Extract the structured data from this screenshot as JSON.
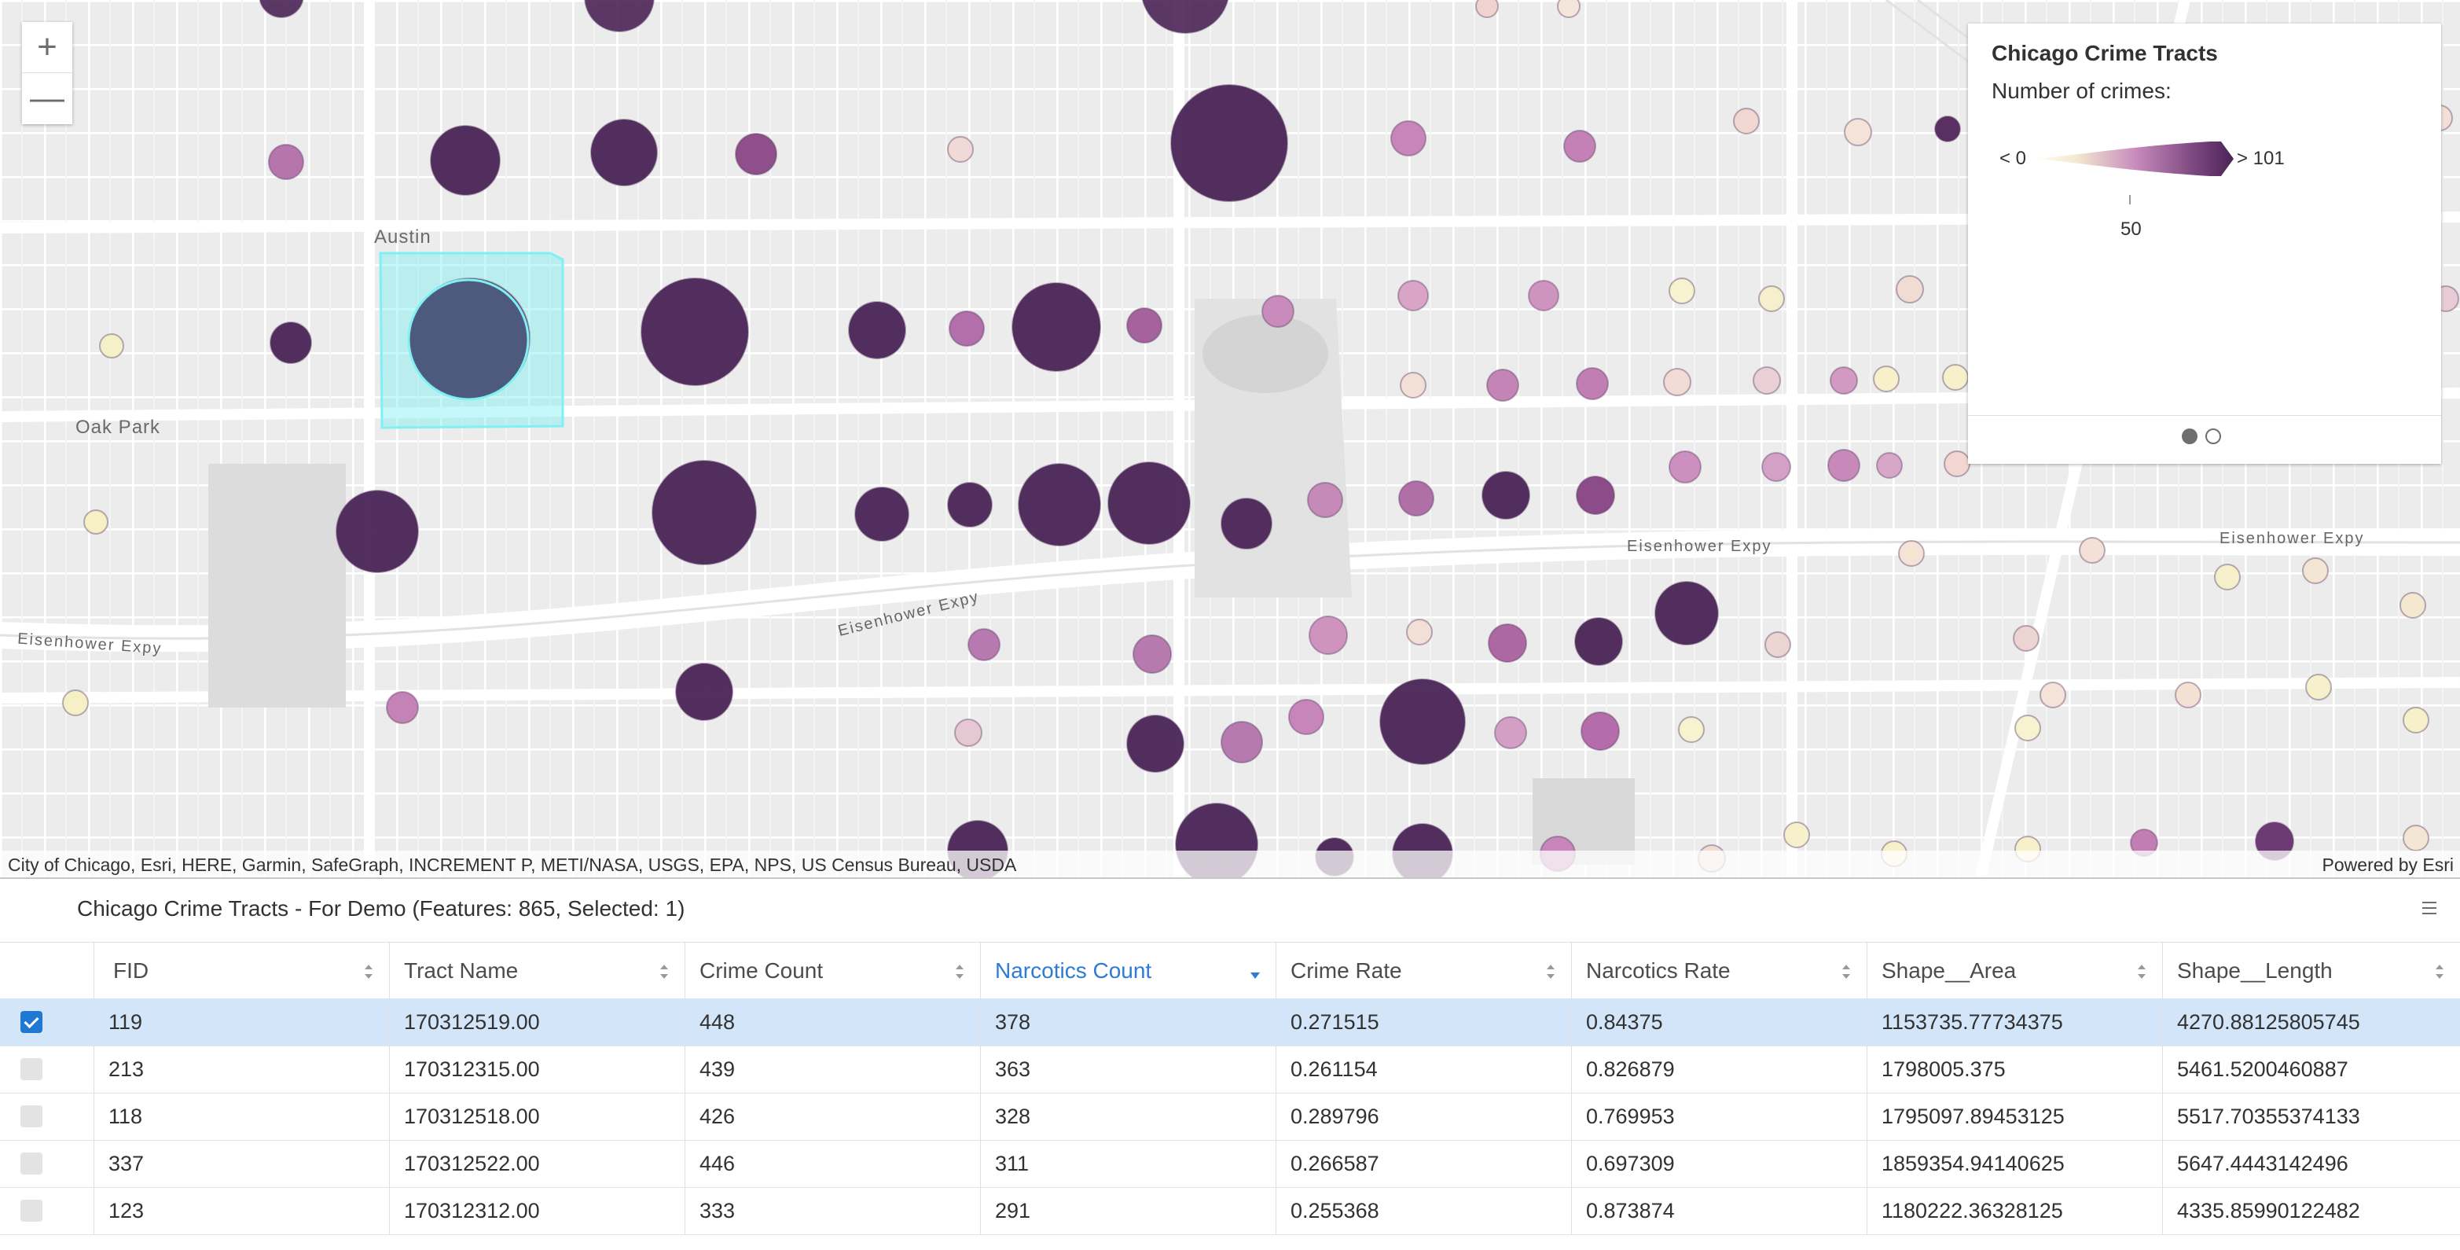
{
  "map": {
    "zoom_in_label": "+",
    "zoom_out_label": "—",
    "place_labels": [
      "Austin",
      "Oak Park"
    ],
    "road_labels": [
      "Eisenhower Expy",
      "Eisenhower Expy",
      "Eisenhower Expy",
      "Eisenhower Expy"
    ],
    "attribution": "City of Chicago, Esri, HERE, Garmin, SafeGraph, INCREMENT P, METI/NASA, USGS, EPA, NPS, US Census Bureau, USDA",
    "powered_by": "Powered by Esri",
    "colors": {
      "dark": "#4a2456",
      "mid": "#b775ad",
      "light": "#f3ecc6",
      "selection": "#7ff1f2"
    }
  },
  "legend": {
    "title": "Chicago Crime Tracts",
    "subtitle": "Number of crimes:",
    "min_label": "< 0",
    "max_label": "> 101",
    "mid_label": "50",
    "pages": 2,
    "current_page": 1
  },
  "table": {
    "title": "Chicago Crime Tracts - For Demo (Features: 865, Selected: 1)",
    "columns": [
      "FID",
      "Tract Name",
      "Crime Count",
      "Narcotics Count",
      "Crime Rate",
      "Narcotics Rate",
      "Shape__Area",
      "Shape__Length"
    ],
    "sorted_column": "Narcotics Count",
    "sort_direction": "descending",
    "rows": [
      {
        "selected": true,
        "cells": [
          "119",
          "170312519.00",
          "448",
          "378",
          "0.271515",
          "0.84375",
          "1153735.77734375",
          "4270.88125805745"
        ]
      },
      {
        "selected": false,
        "cells": [
          "213",
          "170312315.00",
          "439",
          "363",
          "0.261154",
          "0.826879",
          "1798005.375",
          "5461.5200460887"
        ]
      },
      {
        "selected": false,
        "cells": [
          "118",
          "170312518.00",
          "426",
          "328",
          "0.289796",
          "0.769953",
          "1795097.89453125",
          "5517.70355374133"
        ]
      },
      {
        "selected": false,
        "cells": [
          "337",
          "170312522.00",
          "446",
          "311",
          "0.266587",
          "0.697309",
          "1859354.94140625",
          "5647.4443142496"
        ]
      },
      {
        "selected": false,
        "cells": [
          "123",
          "170312312.00",
          "333",
          "291",
          "0.255368",
          "0.873874",
          "1180222.36328125",
          "4335.85990122482"
        ]
      }
    ]
  }
}
